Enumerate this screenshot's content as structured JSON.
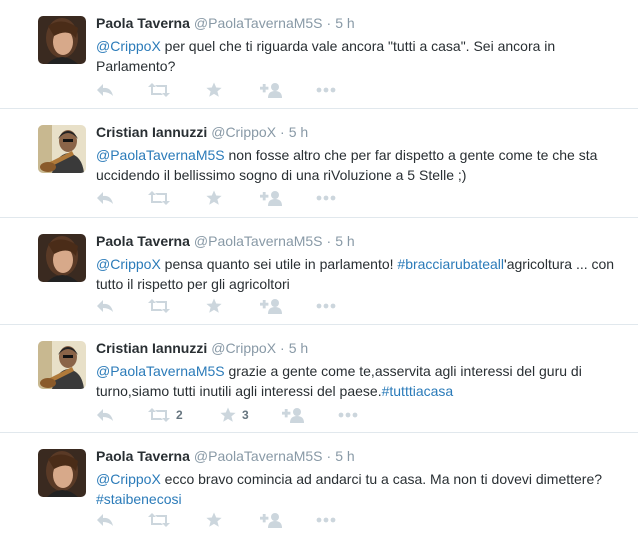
{
  "tweets": [
    {
      "fullname": "Paola Taverna",
      "username": "@PaolaTavernaM5S",
      "time": "5 h",
      "avatar": "woman-portrait",
      "parts": [
        {
          "text": "@CrippoX",
          "link": true
        },
        {
          "text": " per quel che ti riguarda vale ancora \"tutti a casa\". Sei ancora in Parlamento?",
          "link": false
        }
      ],
      "retweets": "",
      "favorites": ""
    },
    {
      "fullname": "Cristian Iannuzzi",
      "username": "@CrippoX",
      "time": "5 h",
      "avatar": "man-guitar",
      "parts": [
        {
          "text": "@PaolaTavernaM5S",
          "link": true
        },
        {
          "text": " non fosse altro che per far dispetto a gente come te che sta uccidendo il bellissimo sogno di una riVoluzione a 5 Stelle ;)",
          "link": false
        }
      ],
      "retweets": "",
      "favorites": ""
    },
    {
      "fullname": "Paola Taverna",
      "username": "@PaolaTavernaM5S",
      "time": "5 h",
      "avatar": "woman-portrait",
      "parts": [
        {
          "text": "@CrippoX",
          "link": true
        },
        {
          "text": " pensa quanto sei utile in parlamento! ",
          "link": false
        },
        {
          "text": "#bracciarubateall",
          "link": true
        },
        {
          "text": "'agricoltura ... con tutto il rispetto per gli agricoltori",
          "link": false
        }
      ],
      "retweets": "",
      "favorites": ""
    },
    {
      "fullname": "Cristian Iannuzzi",
      "username": "@CrippoX",
      "time": "5 h",
      "avatar": "man-guitar",
      "parts": [
        {
          "text": "@PaolaTavernaM5S",
          "link": true
        },
        {
          "text": " grazie a gente come te,asservita agli interessi del guru di turno,siamo tutti inutili agli interessi del paese.",
          "link": false
        },
        {
          "text": "#tutttiacasa",
          "link": true
        }
      ],
      "retweets": "2",
      "favorites": "3"
    },
    {
      "fullname": "Paola Taverna",
      "username": "@PaolaTavernaM5S",
      "time": "5 h",
      "avatar": "woman-portrait",
      "parts": [
        {
          "text": "@CrippoX",
          "link": true
        },
        {
          "text": " ecco bravo comincia ad andarci tu a casa. Ma non ti dovevi dimettere? ",
          "link": false
        },
        {
          "text": "#staibenecosi",
          "link": true
        }
      ],
      "retweets": "",
      "favorites": ""
    }
  ],
  "header_separator": "·",
  "colors": {
    "link": "#2b7bb9",
    "meta": "#8899a6",
    "icon": "#ccd6dd",
    "border": "#e1e8ed"
  }
}
